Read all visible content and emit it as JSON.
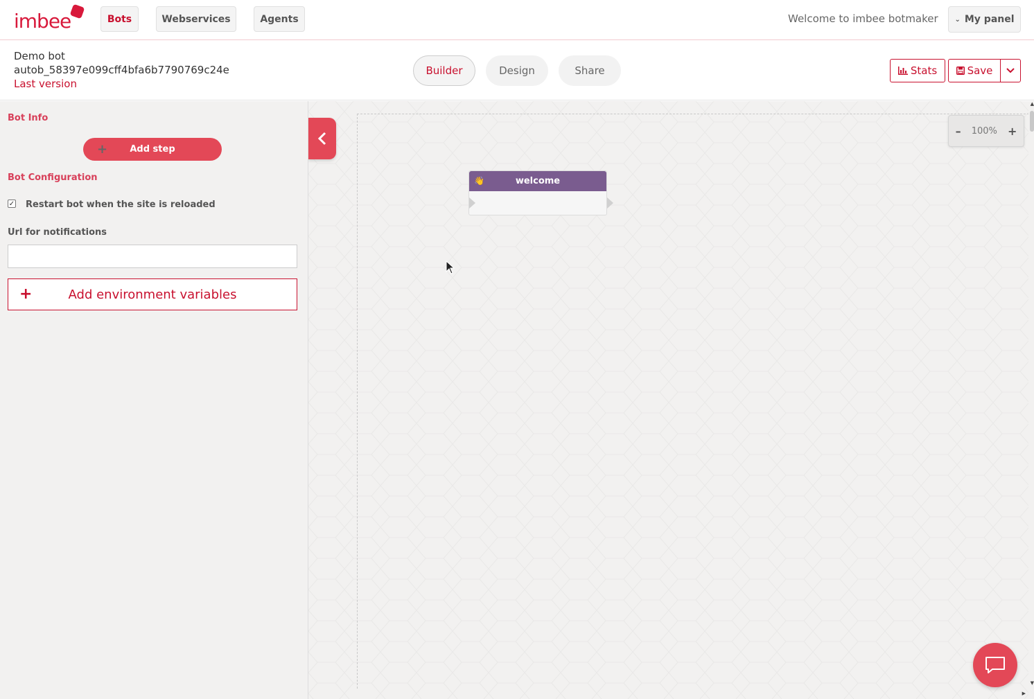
{
  "brand": {
    "logo_text": "imbee"
  },
  "topnav": {
    "items": [
      {
        "label": "Bots",
        "active": true
      },
      {
        "label": "Webservices",
        "active": false
      },
      {
        "label": "Agents",
        "active": false
      }
    ],
    "welcome": "Welcome to imbee botmaker",
    "my_panel": "My panel"
  },
  "bot": {
    "name": "Demo bot",
    "id": "autob_58397e099cff4bfa6b7790769c24e",
    "version": "Last version"
  },
  "tabs": [
    {
      "label": "Builder",
      "active": true
    },
    {
      "label": "Design",
      "active": false
    },
    {
      "label": "Share",
      "active": false
    }
  ],
  "actions": {
    "stats": "Stats",
    "save": "Save"
  },
  "sidebar": {
    "bot_info_title": "Bot Info",
    "add_step": "Add step",
    "config_title": "Bot Configuration",
    "restart_label": "Restart bot when the site is reloaded",
    "restart_checked": true,
    "url_label": "Url for notifications",
    "url_value": "",
    "add_env": "Add environment variables"
  },
  "canvas": {
    "zoom": "100%",
    "nodes": [
      {
        "title": "welcome",
        "icon": "waving-hand-icon"
      }
    ]
  },
  "colors": {
    "accent": "#c8102e",
    "button_red": "#e34857",
    "node_header": "#7a5c8f",
    "canvas_bg": "#f2f1f0"
  }
}
